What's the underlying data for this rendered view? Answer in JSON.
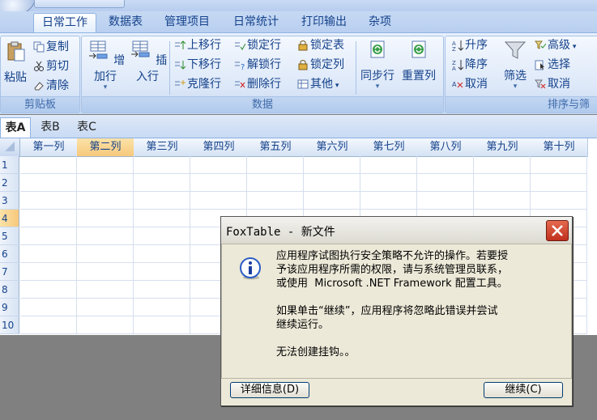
{
  "ribbon": {
    "tabs": [
      "日常工作",
      "数据表",
      "管理项目",
      "日常统计",
      "打印输出",
      "杂项"
    ],
    "active_tab": "日常工作",
    "clipboard": {
      "paste": "粘贴",
      "copy": "复制",
      "cut": "剪切",
      "clear": "清除",
      "label": "剪贴板"
    },
    "data": {
      "add_row": "增加行",
      "insert_row": "插入行",
      "move_up": "上移行",
      "move_down": "下移行",
      "clone_row": "克隆行",
      "lock_row": "锁定行",
      "unlock_row": "解锁行",
      "delete_row": "删除行",
      "lock_table": "锁定表",
      "lock_col": "锁定列",
      "other": "其他",
      "sync_row": "同步行",
      "reset_col": "重置列",
      "label": "数据"
    },
    "sort": {
      "asc": "升序",
      "desc": "降序",
      "cancel": "取消",
      "filter": "筛选",
      "advanced": "高级",
      "select": "选择",
      "cancel2": "取消",
      "label": "排序与筛"
    }
  },
  "sheets": [
    "表A",
    "表B",
    "表C"
  ],
  "columns": [
    "第一列",
    "第二列",
    "第三列",
    "第四列",
    "第五列",
    "第六列",
    "第七列",
    "第八列",
    "第九列",
    "第十列"
  ],
  "rows": [
    "1",
    "2",
    "3",
    "4",
    "5",
    "6",
    "7",
    "8",
    "9",
    "10"
  ],
  "selected_column": 2,
  "selected_row": 4,
  "dialog": {
    "title": "FoxTable - 新文件",
    "message": [
      "应用程序试图执行安全策略不允许的操作。若要授",
      "予该应用程序所需的权限，请与系统管理员联系，",
      "或使用  Microsoft .NET Framework 配置工具。",
      "",
      "如果单击“继续”，应用程序将忽略此错误并尝试",
      "继续运行。",
      "",
      "无法创建挂钩。。"
    ],
    "details_button": "详细信息(D)",
    "continue_button": "继续(C)"
  }
}
